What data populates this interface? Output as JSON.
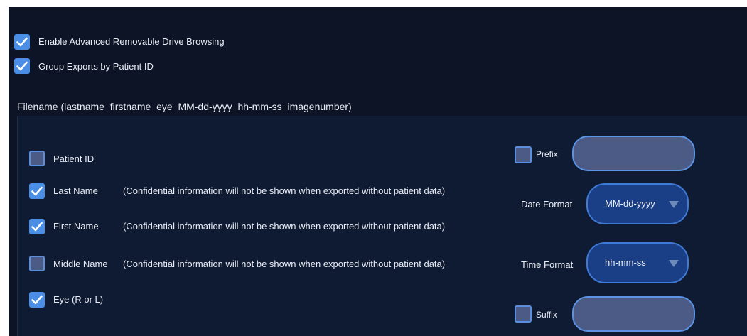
{
  "export_options": {
    "enable_advanced_drive_browsing": {
      "label": "Enable Advanced Removable Drive Browsing",
      "checked": true
    },
    "group_exports_by_patient_id": {
      "label": "Group Exports by Patient ID",
      "checked": true
    }
  },
  "filename": {
    "section_label": "Filename (lastname_firstname_eye_MM-dd-yyyy_hh-mm-ss_imagenumber)",
    "fields": [
      {
        "label": "Patient ID",
        "checked": false,
        "note": ""
      },
      {
        "label": "Last Name",
        "checked": true,
        "note": "(Confidential information will not be shown when exported without patient data)"
      },
      {
        "label": "First Name",
        "checked": true,
        "note": "(Confidential information will not be shown when exported without patient data)"
      },
      {
        "label": "Middle Name",
        "checked": false,
        "note": "(Confidential information will not be shown when exported without patient data)"
      },
      {
        "label": "Eye (R or L)",
        "checked": true,
        "note": ""
      }
    ],
    "prefix": {
      "label": "Prefix",
      "checked": false,
      "value": ""
    },
    "date_format": {
      "label": "Date Format",
      "value": "MM-dd-yyyy"
    },
    "time_format": {
      "label": "Time Format",
      "value": "hh-mm-ss"
    },
    "suffix": {
      "label": "Suffix",
      "checked": false,
      "value": ""
    }
  },
  "colors": {
    "background": "#0c1426",
    "panel": "#0f1a33",
    "checkbox_checked": "#4a8ee6",
    "checkbox_unchecked": "#4c5b86",
    "select_fill": "#1a3f86",
    "text": "#e9edf5"
  },
  "icons": {
    "checked": "checkmark-icon",
    "dropdown": "caret-down-icon"
  }
}
